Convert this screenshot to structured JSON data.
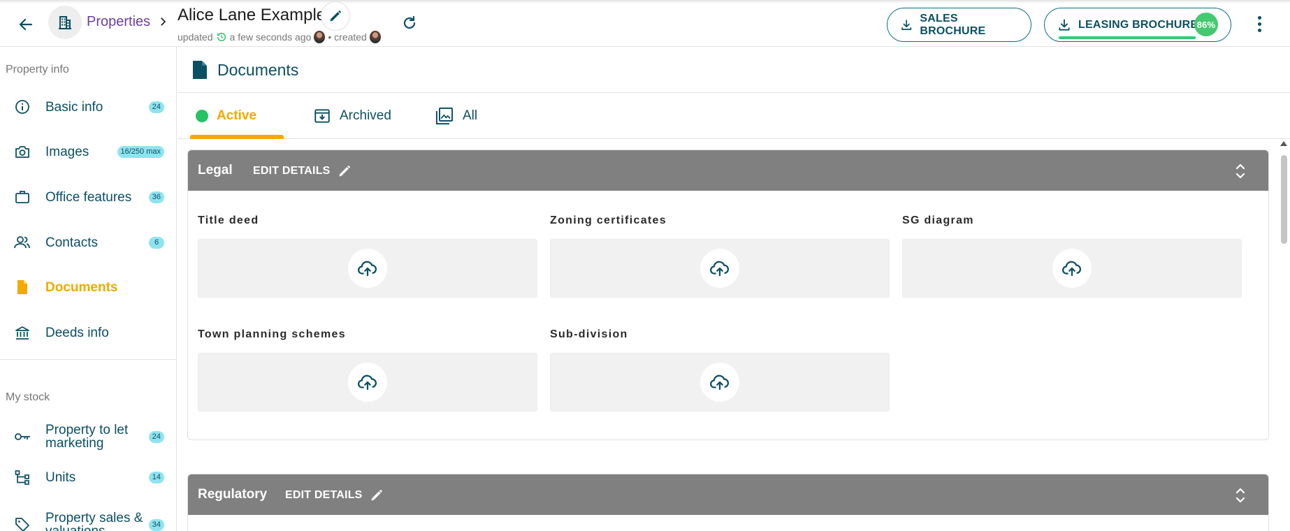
{
  "header": {
    "breadcrumb_label": "Properties",
    "property_title": "Alice Lane Example",
    "meta_updated": "updated",
    "meta_time": "a few seconds ago",
    "meta_created": "• created",
    "sales_brochure_label": "SALES BROCHURE",
    "leasing_brochure_label": "LEASING BROCHURE",
    "leasing_progress": "86%",
    "leasing_progress_value": 0.86
  },
  "sidebar": {
    "property_info_heading": "Property info",
    "my_stock_heading": "My stock",
    "items": [
      {
        "label": "Basic info",
        "count": "24",
        "icon": "info-icon"
      },
      {
        "label": "Images",
        "count": "16/250 max",
        "icon": "camera-icon"
      },
      {
        "label": "Office features",
        "count": "36",
        "icon": "briefcase-icon"
      },
      {
        "label": "Contacts",
        "count": "6",
        "icon": "people-icon"
      },
      {
        "label": "Documents",
        "count": "",
        "icon": "document-icon",
        "active": true
      },
      {
        "label": "Deeds info",
        "count": "",
        "icon": "bank-icon"
      }
    ],
    "stock_items": [
      {
        "label": "Property to let marketing",
        "count": "24",
        "icon": "key-icon"
      },
      {
        "label": "Units",
        "count": "14",
        "icon": "hierarchy-icon"
      },
      {
        "label": "Property sales & valuations",
        "count": "34",
        "icon": "tag-icon"
      }
    ]
  },
  "main": {
    "title": "Documents",
    "tabs": [
      {
        "label": "Active",
        "active": true
      },
      {
        "label": "Archived"
      },
      {
        "label": "All"
      }
    ],
    "sections": [
      {
        "title": "Legal",
        "edit_label": "EDIT DETAILS",
        "fields": [
          "Title deed",
          "Zoning certificates",
          "SG diagram",
          "Town planning schemes",
          "Sub-division"
        ]
      },
      {
        "title": "Regulatory",
        "edit_label": "EDIT DETAILS",
        "fields": []
      }
    ]
  },
  "colors": {
    "primary": "#0b4f63",
    "accent": "#f2a900",
    "breadcrumb": "#6b3fa0",
    "section_header": "#808080",
    "badge": "#8fe3ef",
    "success": "#27c266"
  }
}
